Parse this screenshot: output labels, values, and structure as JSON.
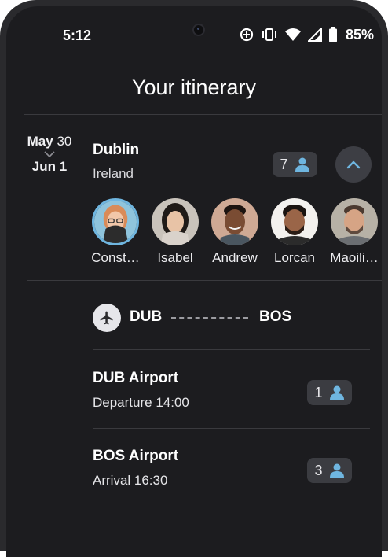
{
  "status_bar": {
    "time": "5:12",
    "battery": "85%",
    "icons": [
      "data-saver-icon",
      "vibrate-icon",
      "wifi-icon",
      "signal-icon",
      "battery-icon"
    ]
  },
  "header": {
    "title": "Your itinerary"
  },
  "trip": {
    "date_start_month": "May",
    "date_start_day": "30",
    "date_end": "Jun 1",
    "city": "Dublin",
    "country": "Ireland",
    "traveler_count": "7",
    "travelers": [
      {
        "name": "Const…",
        "selected": true
      },
      {
        "name": "Isabel",
        "selected": false
      },
      {
        "name": "Andrew",
        "selected": false
      },
      {
        "name": "Lorcan",
        "selected": false
      },
      {
        "name": "Maoili…",
        "selected": false
      }
    ]
  },
  "flight": {
    "from": "DUB",
    "to": "BOS",
    "stops": [
      {
        "title": "DUB Airport",
        "subtitle": "Departure 14:00",
        "count": "1"
      },
      {
        "title": "BOS Airport",
        "subtitle": "Arrival 16:30",
        "count": "3"
      }
    ]
  },
  "colors": {
    "background": "#1c1c1f",
    "accent": "#6fb6e0",
    "pill": "#3b3c41"
  }
}
